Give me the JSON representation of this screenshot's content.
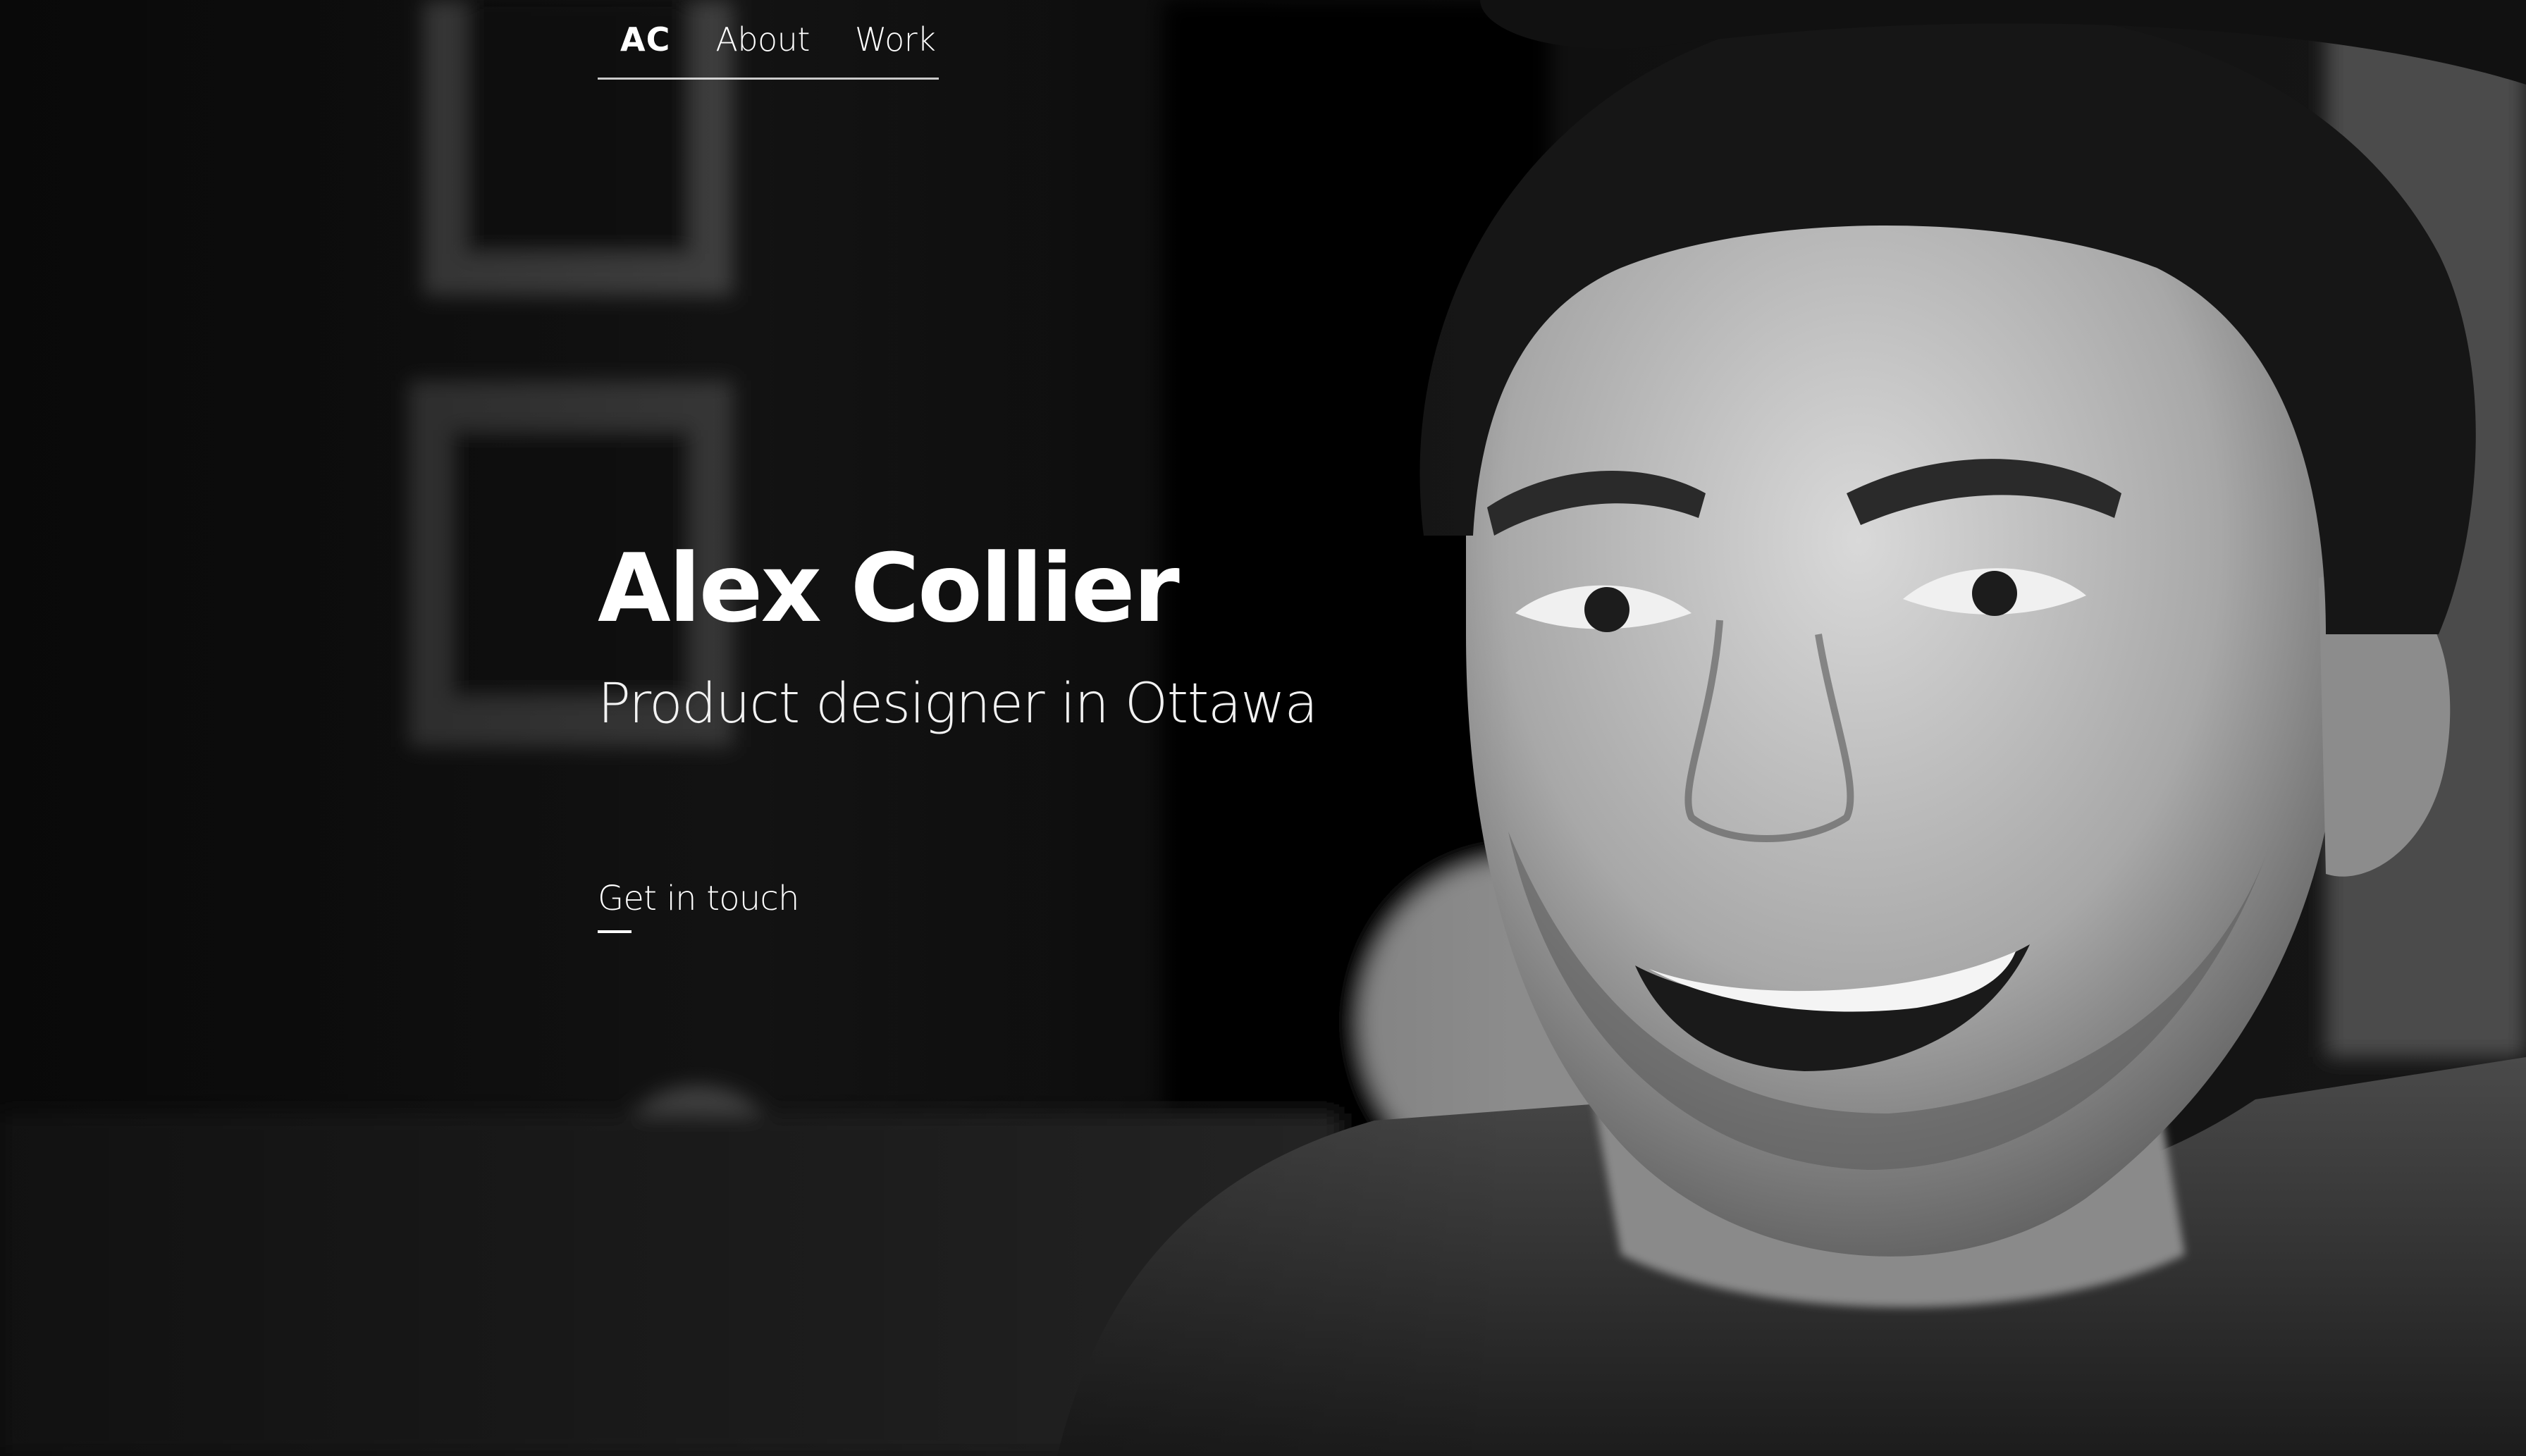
{
  "nav": {
    "logo": "AC",
    "about": "About",
    "work": "Work"
  },
  "hero": {
    "name": "Alex Collier",
    "tagline": "Product designer in Ottawa",
    "cta": "Get in touch"
  },
  "colors": {
    "text": "#ffffff",
    "background": "#0b0b0b"
  }
}
